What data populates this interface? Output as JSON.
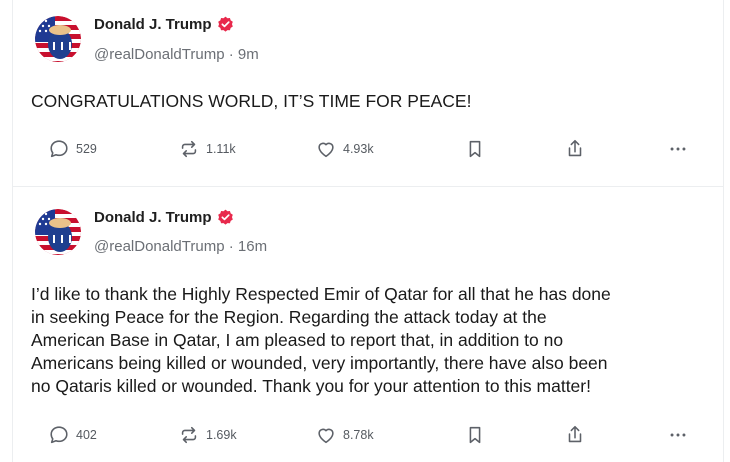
{
  "posts": [
    {
      "author": "Donald J. Trump",
      "handle": "@realDonaldTrump",
      "separator": "·",
      "time": "9m",
      "text": "CONGRATULATIONS WORLD, IT’S TIME FOR PEACE!",
      "replies": "529",
      "retruths": "1.11k",
      "likes": "4.93k"
    },
    {
      "author": "Donald J. Trump",
      "handle": "@realDonaldTrump",
      "separator": "·",
      "time": "16m",
      "text": "I’d like to thank the Highly Respected Emir of Qatar for all that he has done\nin seeking Peace for the Region. Regarding the attack today at the\nAmerican Base in Qatar, I am pleased to report that, in addition to no\nAmericans being killed or wounded, very importantly, there have also been\nno Qataris killed or wounded. Thank you for your attention to this matter!",
      "replies": "402",
      "retruths": "1.69k",
      "likes": "8.78k"
    }
  ],
  "icons": {
    "reply": "speech-bubble-icon",
    "retruth": "repost-arrows-icon",
    "like": "heart-icon",
    "bookmark": "bookmark-icon",
    "share": "share-upload-icon",
    "more": "ellipsis-icon",
    "verified": "verified-badge-icon"
  },
  "colors": {
    "verified_badge": "#e8294c",
    "action_icon": "#5d6168",
    "handle_text": "#6b6f75",
    "divider": "#eceef0"
  }
}
